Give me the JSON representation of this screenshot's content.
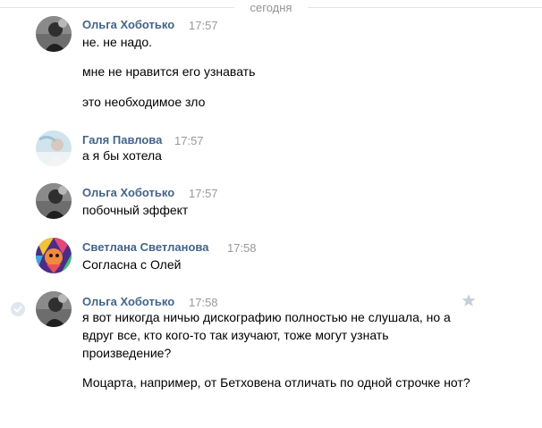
{
  "date_separator": "сегодня",
  "messages": [
    {
      "author": "Ольга Хоботько",
      "time": "17:57",
      "lines": [
        "не. не надо.",
        "мне не нравится его узнавать",
        "это необходимое зло"
      ]
    },
    {
      "author": "Галя Павлова",
      "time": "17:57",
      "lines": [
        "а я бы хотела"
      ]
    },
    {
      "author": "Ольга Хоботько",
      "time": "17:57",
      "lines": [
        "побочный эффект"
      ]
    },
    {
      "author": "Светлана Светланова",
      "time": "17:58",
      "lines": [
        "Согласна с Олей"
      ]
    },
    {
      "author": "Ольга Хоботько",
      "time": "17:58",
      "lines": [
        "я вот никогда ничью дискографию полностью не слушала, но а вдруг все, кто кого-то так изучают, тоже могут узнать произведение?",
        "Моцарта, например, от Бетховена отличать по одной строчке нот?"
      ]
    }
  ],
  "icons": {
    "selected": "check-circle-icon",
    "favorite": "star-icon"
  },
  "colors": {
    "author": "#42648b",
    "time": "#999999",
    "separator": "#939393"
  }
}
